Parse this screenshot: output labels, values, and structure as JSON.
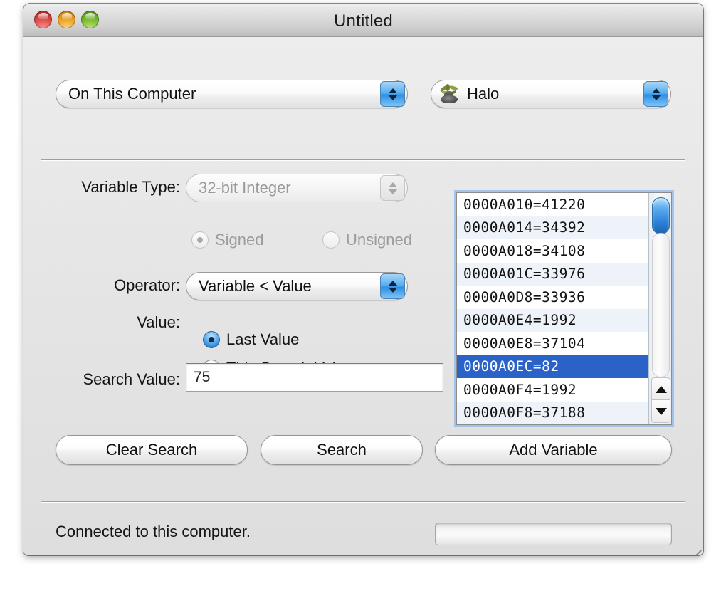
{
  "window": {
    "title": "Untitled",
    "traffic_lights": [
      "close",
      "minimize",
      "zoom"
    ]
  },
  "toolbar": {
    "source_popup": {
      "value": "On This Computer",
      "options": [
        "On This Computer"
      ]
    },
    "target_popup": {
      "value": "Halo",
      "icon": "halo-app-icon",
      "options": [
        "Halo"
      ]
    }
  },
  "search_form": {
    "variable_type": {
      "label": "Variable Type:",
      "value": "32-bit Integer",
      "enabled": false,
      "options": [
        "32-bit Integer"
      ]
    },
    "signedness": {
      "enabled": false,
      "selected": "Signed",
      "options": [
        {
          "label": "Signed",
          "checked": true
        },
        {
          "label": "Unsigned",
          "checked": false
        }
      ]
    },
    "operator": {
      "label": "Operator:",
      "value": "Variable < Value",
      "options": [
        "Variable < Value"
      ]
    },
    "value": {
      "label": "Value:",
      "selected": "Last Value",
      "options": [
        {
          "label": "Last Value",
          "checked": true
        },
        {
          "label": "This Search Value:",
          "checked": false
        }
      ]
    },
    "search_value": {
      "label": "Search Value:",
      "value": "75",
      "placeholder": ""
    }
  },
  "results": {
    "rows": [
      {
        "address": "0000A010",
        "separator": "=",
        "value": "41220",
        "selected": false
      },
      {
        "address": "0000A014",
        "separator": "=",
        "value": "34392",
        "selected": false
      },
      {
        "address": "0000A018",
        "separator": "=",
        "value": "34108",
        "selected": false
      },
      {
        "address": "0000A01C",
        "separator": "=",
        "value": "33976",
        "selected": false
      },
      {
        "address": "0000A0D8",
        "separator": "=",
        "value": "33936",
        "selected": false
      },
      {
        "address": "0000A0E4",
        "separator": "=",
        "value": "1992",
        "selected": false
      },
      {
        "address": "0000A0E8",
        "separator": "=",
        "value": "37104",
        "selected": false
      },
      {
        "address": "0000A0EC",
        "separator": "=",
        "value": "82",
        "selected": true
      },
      {
        "address": "0000A0F4",
        "separator": "=",
        "value": "1992",
        "selected": false
      },
      {
        "address": "0000A0F8",
        "separator": "=",
        "value": "37188",
        "selected": false
      }
    ],
    "scrollbar": {
      "up_arrow": "triangle-up-icon",
      "down_arrow": "triangle-down-icon"
    }
  },
  "buttons": {
    "clear_search": "Clear Search",
    "search": "Search",
    "add_variable": "Add Variable"
  },
  "status": {
    "message": "Connected to this computer.",
    "progress_percent": 0
  },
  "colors": {
    "selection_blue": "#2a62c8",
    "aqua_blue": "#2e90e4",
    "focus_ring": "#7ab0e9",
    "window_bg": "#e6e6e6"
  }
}
